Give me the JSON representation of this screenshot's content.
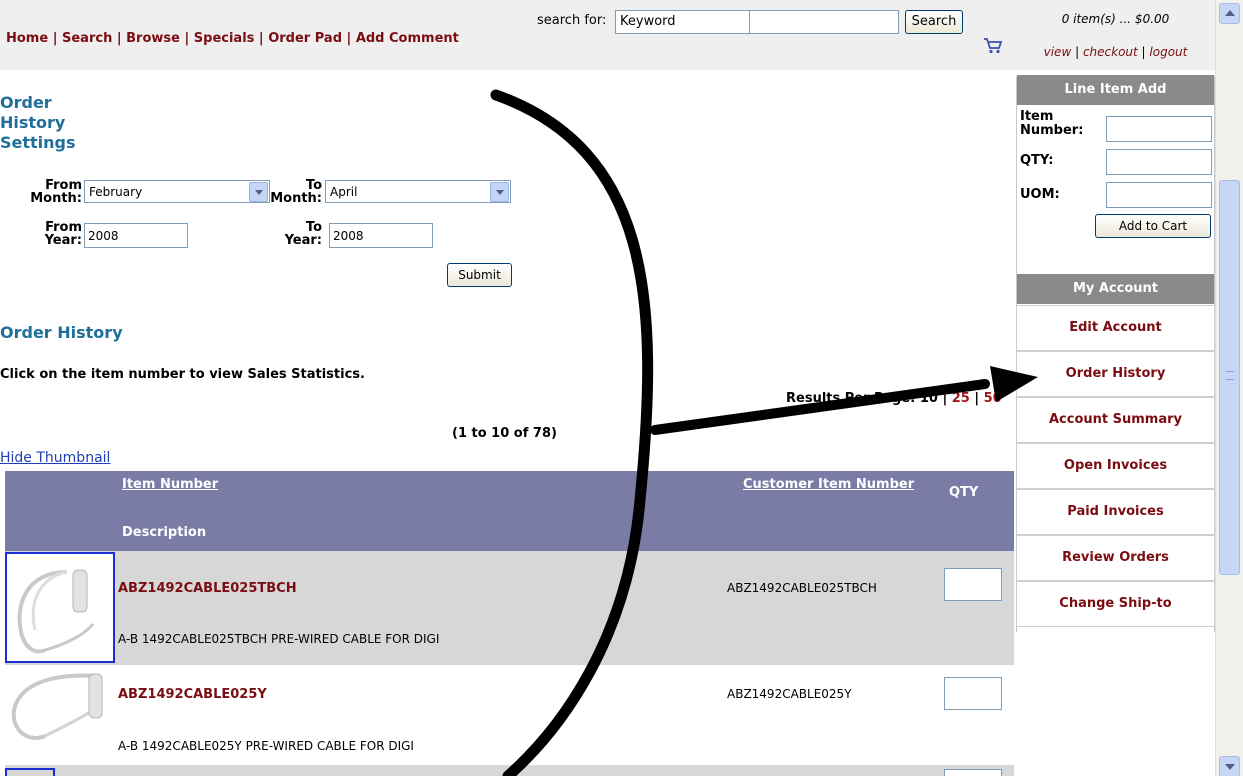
{
  "header": {
    "nav_links": [
      "Home",
      "Search",
      "Browse",
      "Specials",
      "Order Pad",
      "Add Comment"
    ],
    "separator": " | ",
    "search_label": "search for:",
    "search_type": "Keyword",
    "search_value": "",
    "search_button": "Search",
    "cart_summary": "0 item(s) ... $0.00",
    "cart_links": [
      "view",
      "checkout",
      "logout"
    ]
  },
  "settings": {
    "title": "Order History Settings",
    "from_month_label": "From Month:",
    "from_month_value": "February",
    "to_month_label": "To Month:",
    "to_month_value": "April",
    "from_year_label": "From Year:",
    "from_year_value": "2008",
    "to_year_label": "To Year:",
    "to_year_value": "2008",
    "submit_label": "Submit"
  },
  "history": {
    "heading": "Order History",
    "instruction": "Click on the item number to view Sales Statistics.",
    "results_per_page_label": "Results Per Page:",
    "results_options": [
      "10",
      "25",
      "50"
    ],
    "page_range": "(1 to 10 of 78)",
    "hide_thumbnail": "Hide Thumbnail",
    "columns": {
      "item_number": "Item Number",
      "description": "Description",
      "customer_item_number": "Customer Item Number",
      "qty": "QTY"
    },
    "rows": [
      {
        "item_number": "ABZ1492CABLE025TBCH",
        "customer_item_number": "ABZ1492CABLE025TBCH",
        "description": "A-B 1492CABLE025TBCH PRE-WIRED CABLE FOR DIGI",
        "qty": ""
      },
      {
        "item_number": "ABZ1492CABLE025Y",
        "customer_item_number": "ABZ1492CABLE025Y",
        "description": "A-B 1492CABLE025Y PRE-WIRED CABLE FOR DIGI",
        "qty": ""
      }
    ]
  },
  "line_item_add": {
    "title": "Line Item Add",
    "item_number_label": "Item Number:",
    "qty_label": "QTY:",
    "uom_label": "UOM:",
    "item_number_value": "",
    "qty_value": "",
    "uom_value": "",
    "add_to_cart": "Add to Cart"
  },
  "my_account": {
    "title": "My Account",
    "items": [
      "Edit Account",
      "Order History",
      "Account Summary",
      "Open Invoices",
      "Paid Invoices",
      "Review Orders",
      "Change Ship-to"
    ]
  },
  "colors": {
    "nav_link": "#7a0d12",
    "heading_blue": "#1f6f9a",
    "table_header": "#7b7ca6",
    "row_alt": "#d7d7d7",
    "panel_header": "#8a8a8a",
    "thumbnail_border": "#1a2ed6"
  },
  "icons": [
    "shopping-cart-icon",
    "dropdown-arrow-icon",
    "scroll-up-icon",
    "scroll-down-icon"
  ]
}
